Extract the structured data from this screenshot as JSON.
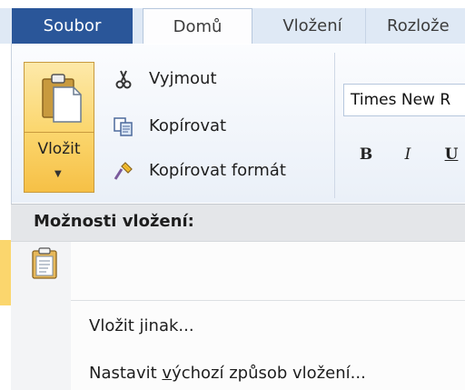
{
  "tabs": {
    "file": "Soubor",
    "home": "Domů",
    "insert": "Vložení",
    "layout": "Rozlože"
  },
  "clipboard": {
    "paste_label": "Vložit",
    "cut": "Vyjmout",
    "copy": "Kopírovat",
    "format_painter": "Kopírovat formát"
  },
  "font": {
    "name": "Times New R",
    "bold": "B",
    "italic": "I",
    "underline": "U"
  },
  "paste_menu": {
    "header": "Možnosti vložení:",
    "items": [
      {
        "label_pre": "Vložit jinak",
        "label_acc": "",
        "label_post": "..."
      },
      {
        "label_pre": "Nastavit ",
        "label_acc": "v",
        "label_post": "ýchozí způsob vložení..."
      }
    ]
  },
  "icons": [
    "paste-icon",
    "scissors-icon",
    "copy-icon",
    "format-painter-icon",
    "keep-text-only-icon",
    "dropdown-caret-icon"
  ],
  "colors": {
    "file_tab": "#2a5699",
    "paste_highlight": "#fbd66d",
    "ribbon_bg": "#eaf0f8"
  }
}
